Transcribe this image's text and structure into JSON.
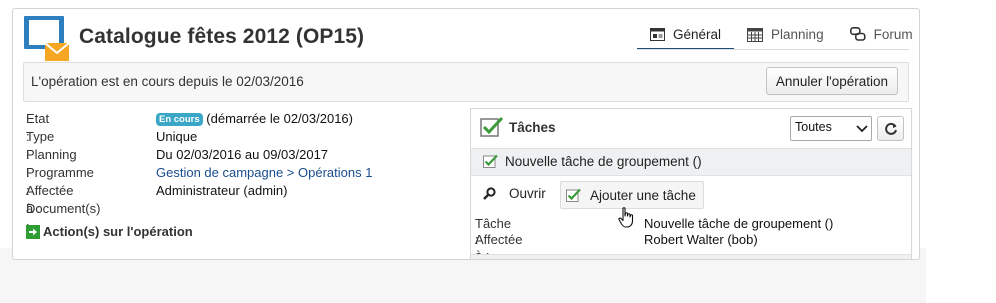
{
  "header": {
    "title": "Catalogue fêtes 2012 (OP15)",
    "tabs": [
      {
        "label": "Général",
        "icon": "general-icon",
        "active": true
      },
      {
        "label": "Planning",
        "icon": "calendar-icon",
        "active": false
      },
      {
        "label": "Forum",
        "icon": "forum-icon",
        "active": false
      }
    ]
  },
  "status": {
    "text": "L'opération est en cours depuis le 02/03/2016",
    "cancel_label": "Annuler l'opération"
  },
  "info": {
    "etat_label": "Etat :",
    "etat_badge": "En cours",
    "etat_value": "(démarrée le 02/03/2016)",
    "type_label": "Type :",
    "type_value": "Unique",
    "planning_label": "Planning :",
    "planning_value": "Du 02/03/2016 au 09/03/2017",
    "programme_label": "Programme :",
    "programme_value": "Gestion de campagne > Opérations 1",
    "affectee_label": "Affectée à :",
    "affectee_value": "Administrateur (admin)",
    "documents_label": "Document(s) :"
  },
  "actions_title": "Action(s) sur l'opération",
  "tasks": {
    "title": "Tâches",
    "filter_selected": "Toutes",
    "group_label": "Nouvelle tâche de groupement ()",
    "open_label": "Ouvrir",
    "add_label": "Ajouter une tâche",
    "task_label": "Tâche :",
    "task_value": "Nouvelle tâche de groupement ()",
    "assigned_label": "Affectée à :",
    "assigned_value": "Robert Walter (bob)"
  },
  "colors": {
    "accent": "#1d4f7c",
    "badge": "#3aa7c7",
    "link": "#1a4d8c",
    "check": "#3c9a3c"
  }
}
